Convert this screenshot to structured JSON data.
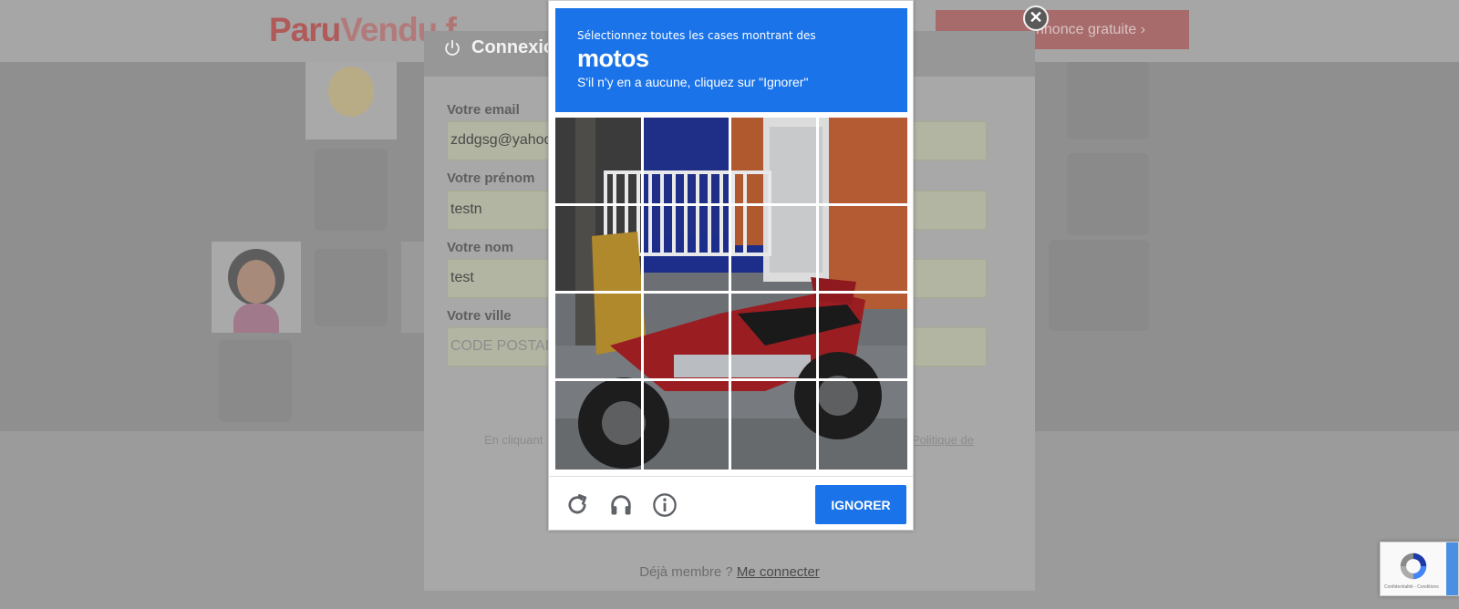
{
  "site": {
    "logo_part1": "Paru",
    "logo_part2": "Vendu",
    "logo_part3": ".f",
    "post_ad_label": "nnonce gratuite",
    "post_ad_chevron": "›"
  },
  "signup_modal": {
    "title": "Connexio",
    "fields": [
      {
        "label": "Votre email",
        "value": "zddgsg@yahoo",
        "placeholder": ""
      },
      {
        "label": "Votre prénom",
        "value": "testn",
        "placeholder": ""
      },
      {
        "label": "Votre nom",
        "value": "test",
        "placeholder": ""
      },
      {
        "label": "Votre ville",
        "value": "",
        "placeholder": "CODE POSTAL"
      }
    ],
    "legal_left": "En cliquant",
    "legal_right_link": "Politique de",
    "already_member_text": "Déjà membre ?",
    "login_link": "Me connecter",
    "close_symbol": "✕"
  },
  "recaptcha": {
    "instruction": "Sélectionnez toutes les cases montrant des",
    "keyword": "motos",
    "fallback": "S'il n'y en a aucune, cliquez sur \"Ignorer\"",
    "grid_rows": 4,
    "grid_cols": 4,
    "tools": [
      "reload-icon",
      "headphones-icon",
      "info-icon"
    ],
    "ignore_label": "IGNORER",
    "header_color": "#1a73e8"
  },
  "recaptcha_badge": {
    "footer_text": "Confidentialité - Conditions"
  },
  "colors": {
    "accent_blue": "#1a73e8",
    "overlay_grey": "#8f8f8f"
  }
}
